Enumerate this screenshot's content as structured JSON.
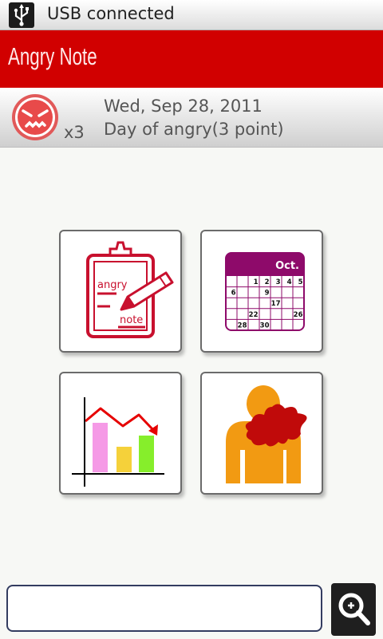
{
  "status_bar": {
    "notification": "USB connected",
    "icon": "usb-icon"
  },
  "app": {
    "title": "Angry Note"
  },
  "summary": {
    "count": "x3",
    "date": "Wed, Sep 28, 2011",
    "day_label": "Day of angry(3 point)",
    "icon": "angry-face-icon"
  },
  "menu": {
    "note_tile": {
      "icon": "angry-note-icon",
      "label_top": "angry",
      "label_bottom": "note"
    },
    "calendar_tile": {
      "icon": "calendar-icon",
      "month": "Oct.",
      "days": [
        "1",
        "2",
        "3",
        "4",
        "5",
        "6",
        "9",
        "17",
        "22",
        "26",
        "28",
        "30"
      ]
    },
    "chart_tile": {
      "icon": "bar-chart-icon"
    },
    "person_tile": {
      "icon": "angry-person-icon"
    }
  },
  "search": {
    "value": "",
    "icon": "search-icon"
  },
  "colors": {
    "title_bar": "#d10000",
    "note_red": "#c8102e",
    "calendar_header": "#8e0a6a",
    "person_orange": "#f29a12",
    "splat_red": "#c00a0a"
  }
}
